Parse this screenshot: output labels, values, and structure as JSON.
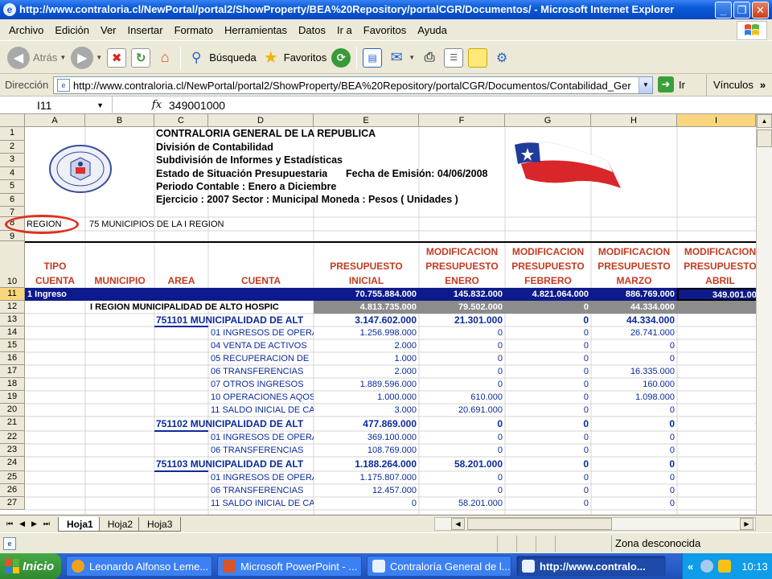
{
  "window": {
    "title": "http://www.contraloria.cl/NewPortal/portal2/ShowProperty/BEA%20Repository/portalCGR/Documentos/ - Microsoft Internet Explorer",
    "min": "_",
    "max": "❐",
    "close": "✕"
  },
  "menu": [
    "Archivo",
    "Edición",
    "Ver",
    "Insertar",
    "Formato",
    "Herramientas",
    "Datos",
    "Ir a",
    "Favoritos",
    "Ayuda"
  ],
  "toolbar": {
    "back": "Atrás",
    "search": "Búsqueda",
    "favorites": "Favoritos"
  },
  "address": {
    "label": "Dirección",
    "url": "http://www.contraloria.cl/NewPortal/portal2/ShowProperty/BEA%20Repository/portalCGR/Documentos/Contabilidad_Ger",
    "go": "Ir",
    "links": "Vínculos"
  },
  "formula": {
    "cell": "I11",
    "fx": "fx",
    "value": "349001000"
  },
  "columns": [
    "A",
    "B",
    "C",
    "D",
    "E",
    "F",
    "G",
    "H",
    "I"
  ],
  "rows": [
    "1",
    "2",
    "3",
    "4",
    "5",
    "6",
    "7",
    "8",
    "9",
    "10",
    "11",
    "12",
    "13",
    "14",
    "15",
    "16",
    "17",
    "18",
    "19",
    "20",
    "21",
    "22",
    "23",
    "24",
    "25",
    "26",
    "27"
  ],
  "header": {
    "line1": "CONTRALORIA GENERAL DE LA REPUBLICA",
    "line2": "División de Contabilidad",
    "line3": "Subdivisión de Informes y Estadísticas",
    "line4a": "Estado de Situación Presupuestaria",
    "line4b": "Fecha de Emisión:  04/06/2008",
    "line5": "Periodo Contable : Enero a Diciembre",
    "line6": "Ejercicio : 2007    Sector : Municipal    Moneda : Pesos ( Unidades )"
  },
  "region": {
    "label": "REGION",
    "value": "75 MUNICIPIOS DE LA I REGION"
  },
  "col_headers": {
    "tipo": [
      "TIPO",
      "CUENTA"
    ],
    "municipio": "MUNICIPIO",
    "area": "AREA",
    "cuenta": "CUENTA",
    "presupuesto": [
      "PRESUPUESTO",
      "INICIAL"
    ],
    "enero": [
      "MODIFICACION",
      "PRESUPUESTO",
      "ENERO"
    ],
    "febrero": [
      "MODIFICACION",
      "PRESUPUESTO",
      "FEBRERO"
    ],
    "marzo": [
      "MODIFICACION",
      "PRESUPUESTO",
      "MARZO"
    ],
    "abril": [
      "MODIFICACION",
      "PRESUPUESTO",
      "ABRIL"
    ]
  },
  "row11": {
    "label": "1 Ingreso",
    "e": "70.755.884.000",
    "f": "145.832.000",
    "g": "4.821.064.000",
    "h": "886.769.000",
    "i": "349.001.000"
  },
  "row12": {
    "label": "I REGION MUNICIPALIDAD DE ALTO HOSPIC",
    "e": "4.813.735.000",
    "f": "79.502.000",
    "g": "0",
    "h": "44.334.000",
    "i": "0"
  },
  "detail": [
    {
      "row": 13,
      "kind": "muni",
      "d": "751101 MUNICIPALIDAD DE ALT",
      "e": "3.147.602.000",
      "f": "21.301.000",
      "g": "0",
      "h": "44.334.000",
      "i": "0"
    },
    {
      "row": 14,
      "kind": "item",
      "d": "01 INGRESOS DE OPERA",
      "e": "1.256.998.000",
      "f": "0",
      "g": "0",
      "h": "26.741.000"
    },
    {
      "row": 15,
      "kind": "item",
      "d": "04 VENTA DE ACTIVOS",
      "e": "2.000",
      "f": "0",
      "g": "0",
      "h": "0"
    },
    {
      "row": 16,
      "kind": "item",
      "d": "05 RECUPERACION DE",
      "e": "1.000",
      "f": "0",
      "g": "0",
      "h": "0"
    },
    {
      "row": 17,
      "kind": "item",
      "d": "06 TRANSFERENCIAS",
      "e": "2.000",
      "f": "0",
      "g": "0",
      "h": "16.335.000"
    },
    {
      "row": 18,
      "kind": "item",
      "d": "07 OTROS INGRESOS",
      "e": "1.889.596.000",
      "f": "0",
      "g": "0",
      "h": "160.000"
    },
    {
      "row": 19,
      "kind": "item",
      "d": "10 OPERACIONES AQOS",
      "e": "1.000.000",
      "f": "610.000",
      "g": "0",
      "h": "1.098.000"
    },
    {
      "row": 20,
      "kind": "item",
      "d": "11 SALDO INICIAL DE CA",
      "e": "3.000",
      "f": "20.691.000",
      "g": "0",
      "h": "0"
    },
    {
      "row": 21,
      "kind": "muni",
      "d": "751102 MUNICIPALIDAD DE ALT",
      "e": "477.869.000",
      "f": "0",
      "g": "0",
      "h": "0",
      "i": "0"
    },
    {
      "row": 22,
      "kind": "item",
      "d": "01 INGRESOS DE OPERA",
      "e": "369.100.000",
      "f": "0",
      "g": "0",
      "h": "0"
    },
    {
      "row": 23,
      "kind": "item",
      "d": "06 TRANSFERENCIAS",
      "e": "108.769.000",
      "f": "0",
      "g": "0",
      "h": "0"
    },
    {
      "row": 24,
      "kind": "muni",
      "d": "751103 MUNICIPALIDAD DE ALT",
      "e": "1.188.264.000",
      "f": "58.201.000",
      "g": "0",
      "h": "0",
      "i": "0"
    },
    {
      "row": 25,
      "kind": "item",
      "d": "01 INGRESOS DE OPERA",
      "e": "1.175.807.000",
      "f": "0",
      "g": "0",
      "h": "0"
    },
    {
      "row": 26,
      "kind": "item",
      "d": "06 TRANSFERENCIAS",
      "e": "12.457.000",
      "f": "0",
      "g": "0",
      "h": "0"
    },
    {
      "row": 27,
      "kind": "item",
      "d": "11 SALDO INICIAL DE CA",
      "e": "0",
      "f": "58.201.000",
      "g": "0",
      "h": "0"
    }
  ],
  "sheets": [
    "Hoja1",
    "Hoja2",
    "Hoja3"
  ],
  "status": {
    "zone": "Zona desconocida"
  },
  "taskbar": {
    "start": "Inicio",
    "items": [
      "Leonardo Alfonso Leme...",
      "Microsoft PowerPoint - ...",
      "Contraloría General de l...",
      "http://www.contralo..."
    ],
    "tray_chevron": "«",
    "clock": "10:13"
  },
  "colors": {
    "navy_row": "#0d1a8c",
    "gray_row": "#8c8c8c",
    "header_red": "#c43b20",
    "data_blue": "#0a2a9b",
    "circle_red": "#e0301e"
  }
}
